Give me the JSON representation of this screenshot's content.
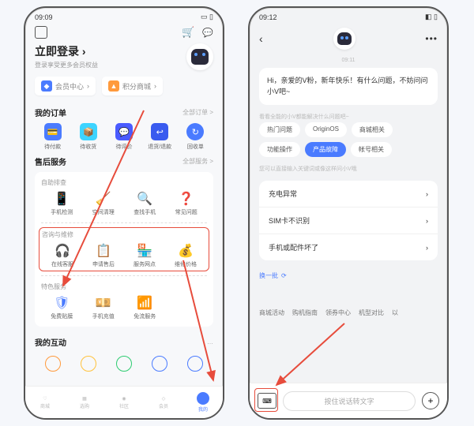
{
  "left": {
    "time": "09:09",
    "login_title": "立即登录",
    "login_sub": "登录享受更多会员权益",
    "chips": {
      "member": "会员中心",
      "points": "积分商城"
    },
    "orders": {
      "title": "我的订单",
      "more": "全部订单 >",
      "items": [
        "待付款",
        "待收货",
        "待评价",
        "退货/退款",
        "回收单"
      ]
    },
    "after": {
      "title": "售后服务",
      "more": "全部服务 >"
    },
    "diag": {
      "title": "自助排查",
      "items": [
        "手机检测",
        "空间清理",
        "查找手机",
        "常见问题"
      ]
    },
    "repair": {
      "title": "咨询与维修",
      "items": [
        "在线客服",
        "申请售后",
        "服务网点",
        "维修价格"
      ]
    },
    "feature": {
      "title": "特色服务",
      "items": [
        "免费贴膜",
        "手机充值",
        "免流服务"
      ]
    },
    "interact": {
      "title": "我的互动",
      "more": "…"
    },
    "tabs": [
      "商城",
      "选购",
      "社区",
      "会员",
      "我的"
    ]
  },
  "right": {
    "time": "09:12",
    "ts": "09:11",
    "greet": "Hi，亲爱的V粉，新年快乐！有什么问题，不妨问问小V吧~",
    "hint": "看看全能的小V都能解决什么问题吧~",
    "cats": [
      "热门问题",
      "OriginOS",
      "商城相关",
      "功能操作",
      "产品故障",
      "帐号相关"
    ],
    "tip2": "您可以直接输入关键词或像这样问小V哦",
    "list": [
      "充电异常",
      "SIM卡不识别",
      "手机或配件坏了"
    ],
    "refresh": "换一批",
    "bottom": [
      "商城活动",
      "购机指南",
      "领券中心",
      "机型对比",
      "以"
    ],
    "placeholder": "按住说话转文字"
  }
}
